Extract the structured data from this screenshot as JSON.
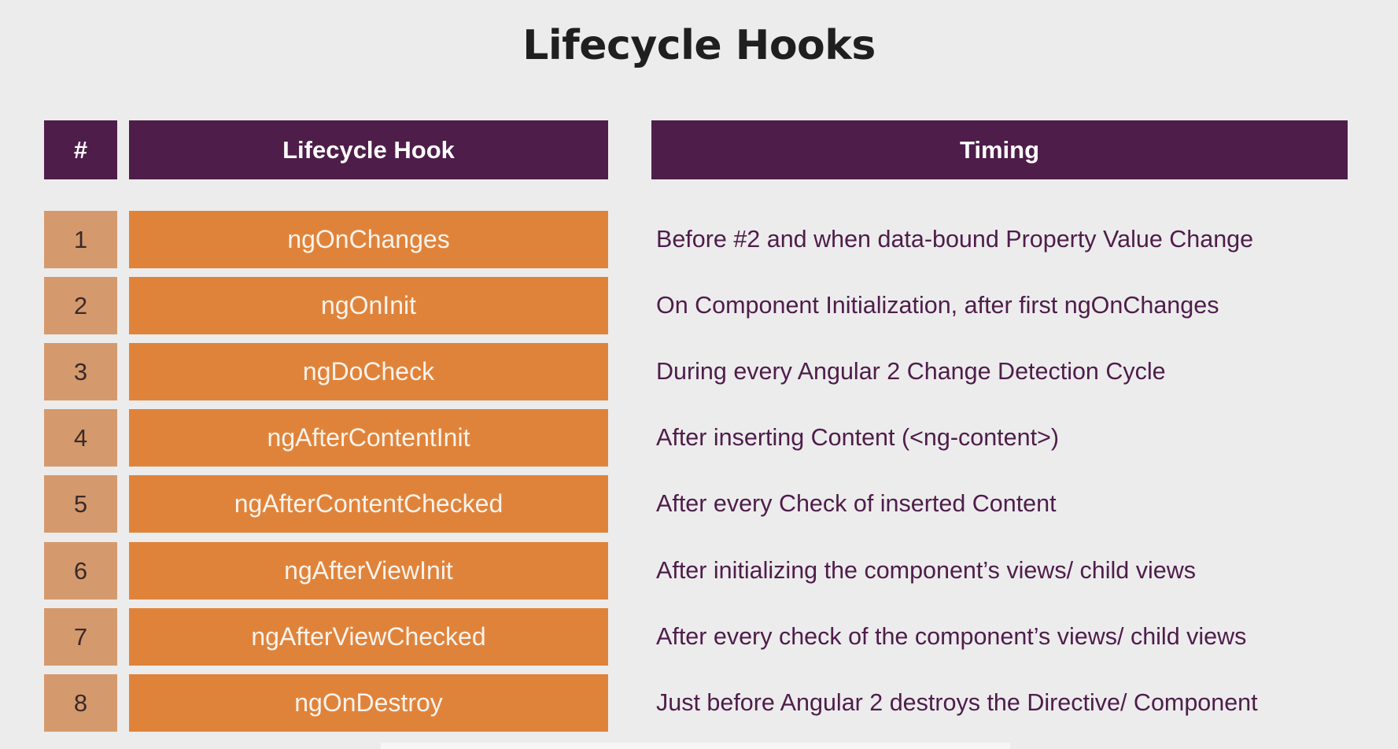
{
  "title": "Lifecycle Hooks",
  "headers": {
    "num": "#",
    "hook": "Lifecycle Hook",
    "timing": "Timing"
  },
  "rows": [
    {
      "num": "1",
      "hook": "ngOnChanges",
      "timing": "Before #2 and when data-bound Property Value Change"
    },
    {
      "num": "2",
      "hook": "ngOnInit",
      "timing": "On Component Initialization, after first ngOnChanges"
    },
    {
      "num": "3",
      "hook": "ngDoCheck",
      "timing": "During every Angular 2 Change Detection Cycle"
    },
    {
      "num": "4",
      "hook": "ngAfterContentInit",
      "timing": "After inserting Content (<ng-content>)"
    },
    {
      "num": "5",
      "hook": "ngAfterContentChecked",
      "timing": "After every Check of inserted Content"
    },
    {
      "num": "6",
      "hook": "ngAfterViewInit",
      "timing": "After initializing the component’s views/ child views"
    },
    {
      "num": "7",
      "hook": "ngAfterViewChecked",
      "timing": "After every check of the component’s views/ child views"
    },
    {
      "num": "8",
      "hook": "ngOnDestroy",
      "timing": "Just before Angular 2 destroys the Directive/ Component"
    }
  ],
  "colors": {
    "header_bg": "#4e1d4a",
    "hook_bg": "#e0833a",
    "num_bg": "#d49a6d",
    "timing_text": "#4e1d4a",
    "page_bg": "#ececec"
  }
}
